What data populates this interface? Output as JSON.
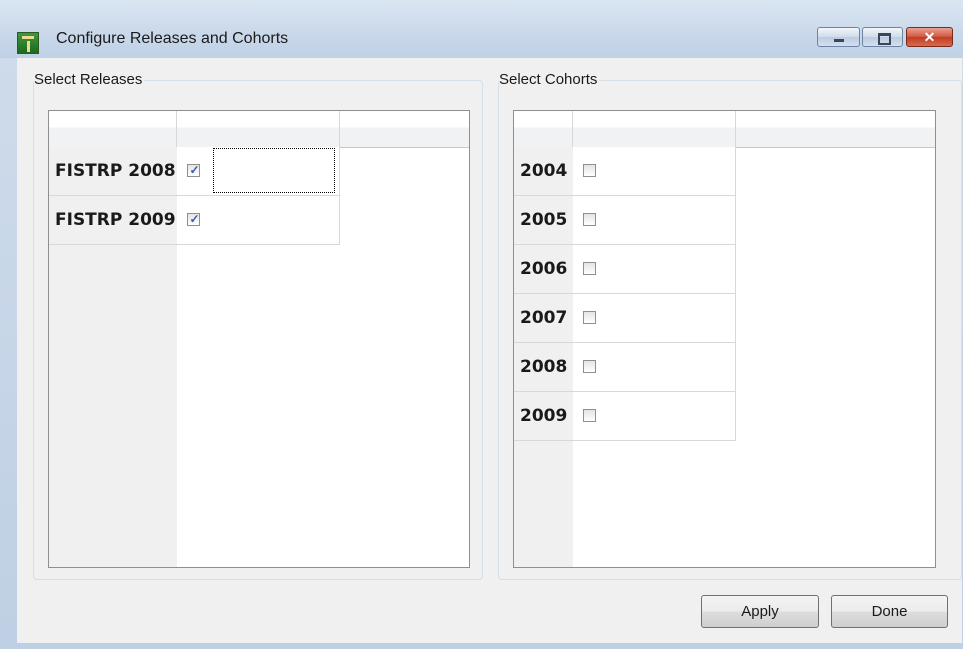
{
  "window": {
    "title": "Configure Releases and Cohorts",
    "icons": {
      "app": "tree-icon",
      "minimize": "minimize-icon",
      "maximize": "maximize-icon",
      "close": "close-icon"
    },
    "close_glyph": "✕"
  },
  "releases": {
    "group_title": "Select Releases",
    "rows": [
      {
        "label": "FISTRP 2008",
        "checked": true
      },
      {
        "label": "FISTRP 2009",
        "checked": true
      }
    ]
  },
  "cohorts": {
    "group_title": "Select Cohorts",
    "rows": [
      {
        "label": "2004",
        "checked": false
      },
      {
        "label": "2005",
        "checked": false
      },
      {
        "label": "2006",
        "checked": false
      },
      {
        "label": "2007",
        "checked": false
      },
      {
        "label": "2008",
        "checked": false
      },
      {
        "label": "2009",
        "checked": false
      }
    ]
  },
  "buttons": {
    "apply": "Apply",
    "done": "Done"
  },
  "colors": {
    "check_mark": "#3b5aa8",
    "close_button": "#c23a22"
  },
  "check_glyph": "✓"
}
